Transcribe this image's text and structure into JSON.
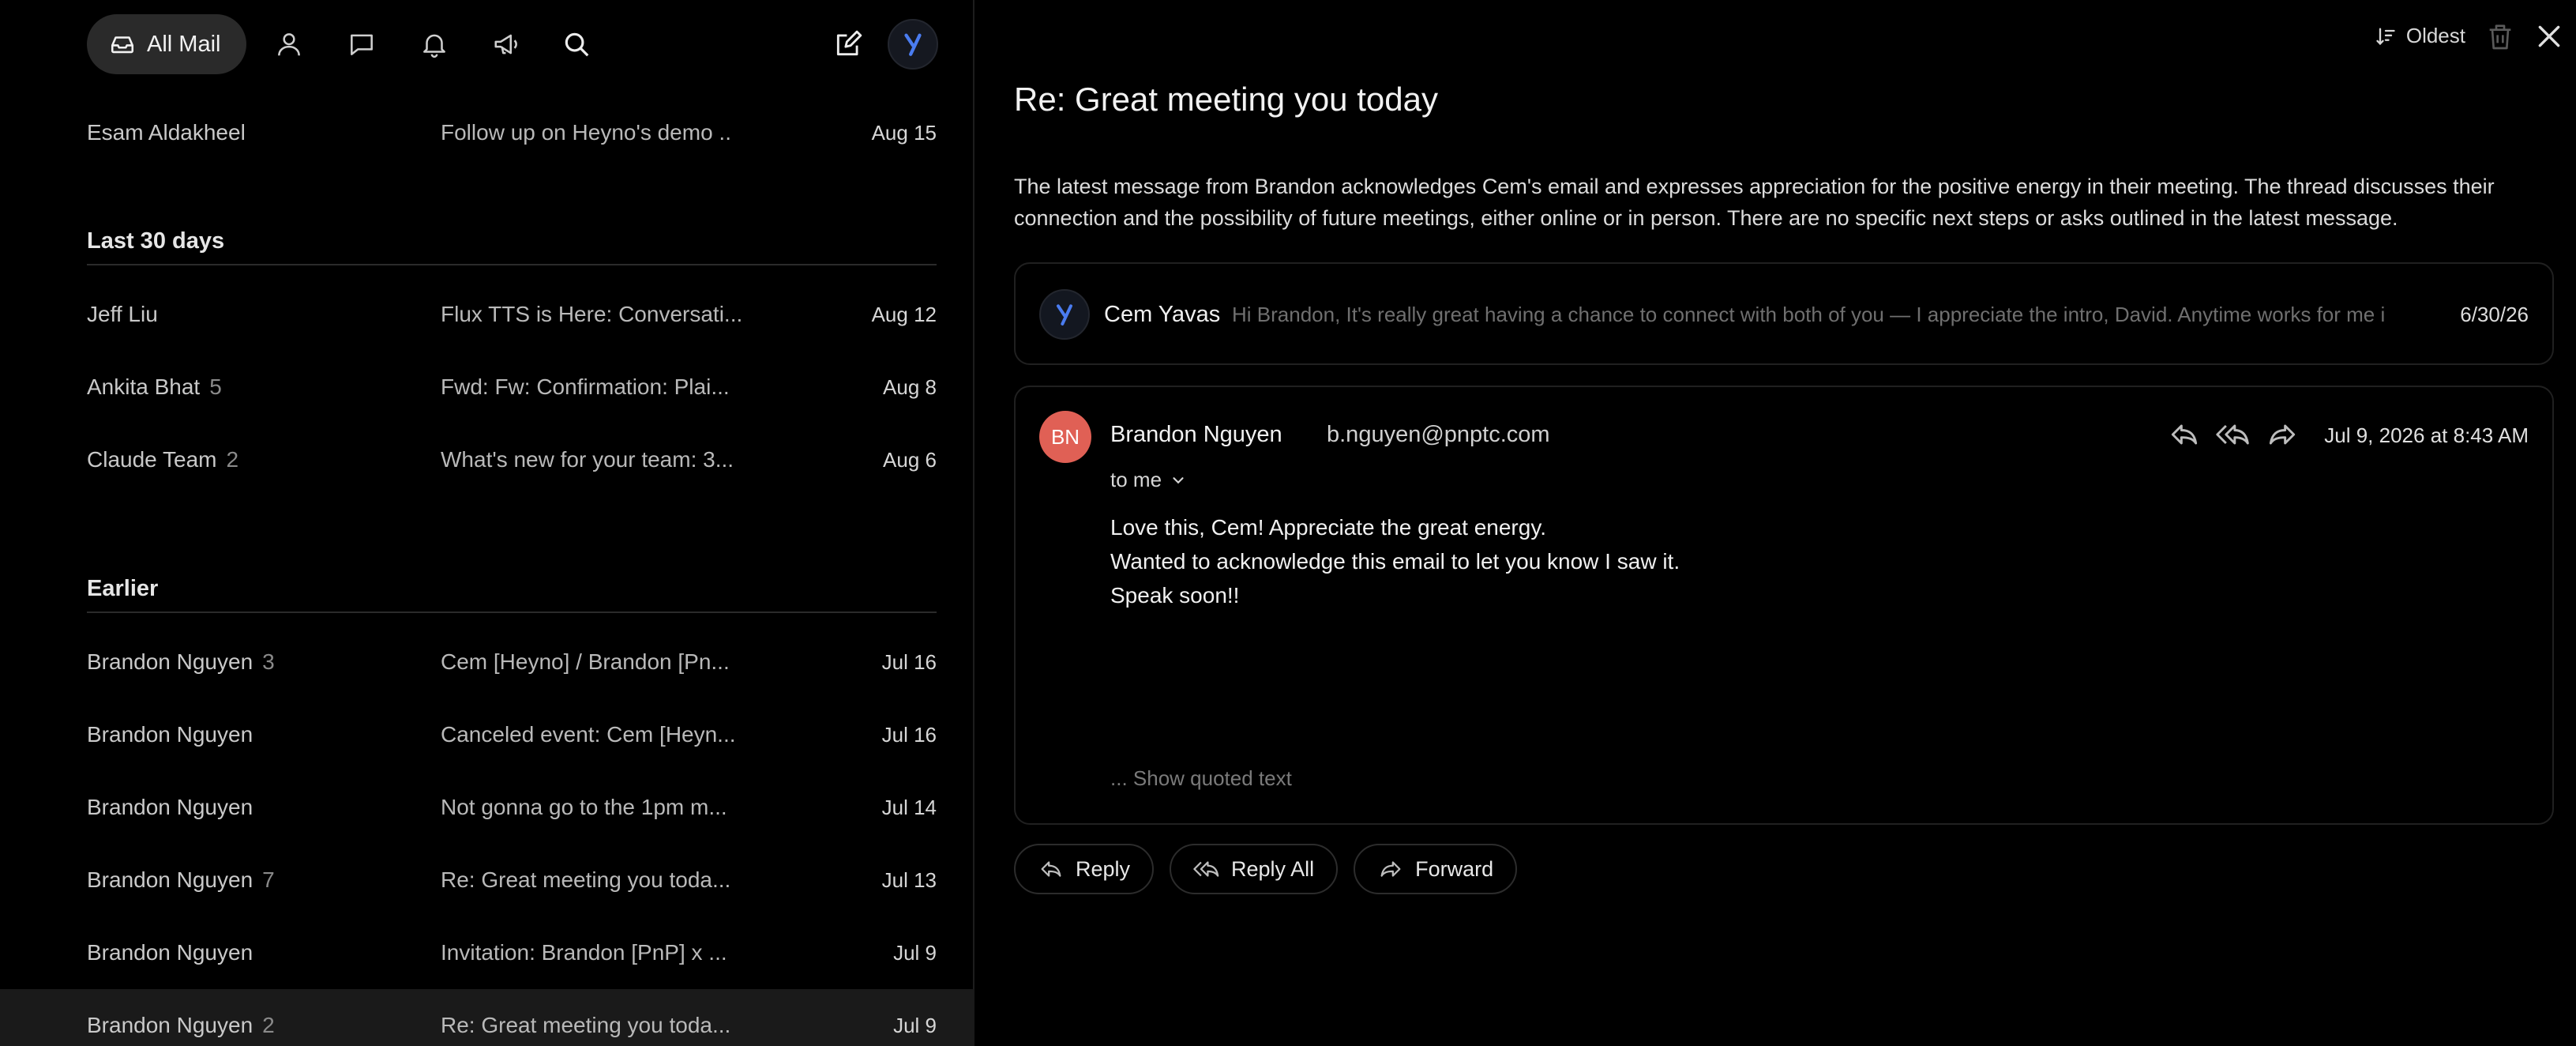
{
  "toolbar": {
    "all_mail_label": "All Mail"
  },
  "sections": {
    "last30": "Last 30 days",
    "earlier": "Earlier"
  },
  "top_row": {
    "sender": "Esam Aldakheel",
    "count": "",
    "subject": "Follow up on Heyno's demo ..",
    "date": "Aug 15"
  },
  "last30_rows": [
    {
      "sender": "Jeff Liu",
      "count": "",
      "subject": "Flux TTS is Here: Conversati...",
      "date": "Aug 12"
    },
    {
      "sender": "Ankita Bhat",
      "count": "5",
      "subject": "Fwd: Fw: Confirmation: Plai...",
      "date": "Aug 8"
    },
    {
      "sender": "Claude Team",
      "count": "2",
      "subject": "What's new for your team: 3...",
      "date": "Aug 6"
    }
  ],
  "earlier_rows": [
    {
      "sender": "Brandon Nguyen",
      "count": "3",
      "subject": "Cem [Heyno] / Brandon [Pn...",
      "date": "Jul 16"
    },
    {
      "sender": "Brandon Nguyen",
      "count": "",
      "subject": "Canceled event: Cem [Heyn...",
      "date": "Jul 16"
    },
    {
      "sender": "Brandon Nguyen",
      "count": "",
      "subject": "Not gonna go to the 1pm m...",
      "date": "Jul 14"
    },
    {
      "sender": "Brandon Nguyen",
      "count": "7",
      "subject": "Re: Great meeting you toda...",
      "date": "Jul 13"
    },
    {
      "sender": "Brandon Nguyen",
      "count": "",
      "subject": "Invitation: Brandon [PnP] x ...",
      "date": "Jul 9"
    },
    {
      "sender": "Brandon Nguyen",
      "count": "2",
      "subject": "Re: Great meeting you toda...",
      "date": "Jul 9",
      "selected": true
    }
  ],
  "reader": {
    "sort_label": "Oldest",
    "title": "Re: Great meeting you today",
    "summary": "The latest message from Brandon acknowledges Cem's email and expresses appreciation for the positive energy in their meeting. The thread discusses their connection and the possibility of future meetings, either online or in person. There are no specific next steps or asks outlined in the latest message.",
    "collapsed": {
      "name": "Cem Yavas",
      "preview": "Hi Brandon, It's really great having a chance to connect with both of you — I appreciate the intro, David. Anytime works for me if ...",
      "date": "6/30/26"
    },
    "message": {
      "initials": "BN",
      "name": "Brandon Nguyen",
      "email": "b.nguyen@pnptc.com",
      "date": "Jul 9, 2026 at 8:43 AM",
      "to": "to me",
      "lines": [
        "Love this, Cem! Appreciate the great energy.",
        "Wanted to acknowledge this email to let you know I saw it.",
        "Speak soon!!"
      ],
      "quoted": "... Show quoted text"
    },
    "buttons": {
      "reply": "Reply",
      "reply_all": "Reply All",
      "forward": "Forward"
    }
  },
  "colors": {
    "avatar_bn": "#e06055",
    "brand_y": "#4a7cf0",
    "selected_row": "#1a1a1a"
  }
}
